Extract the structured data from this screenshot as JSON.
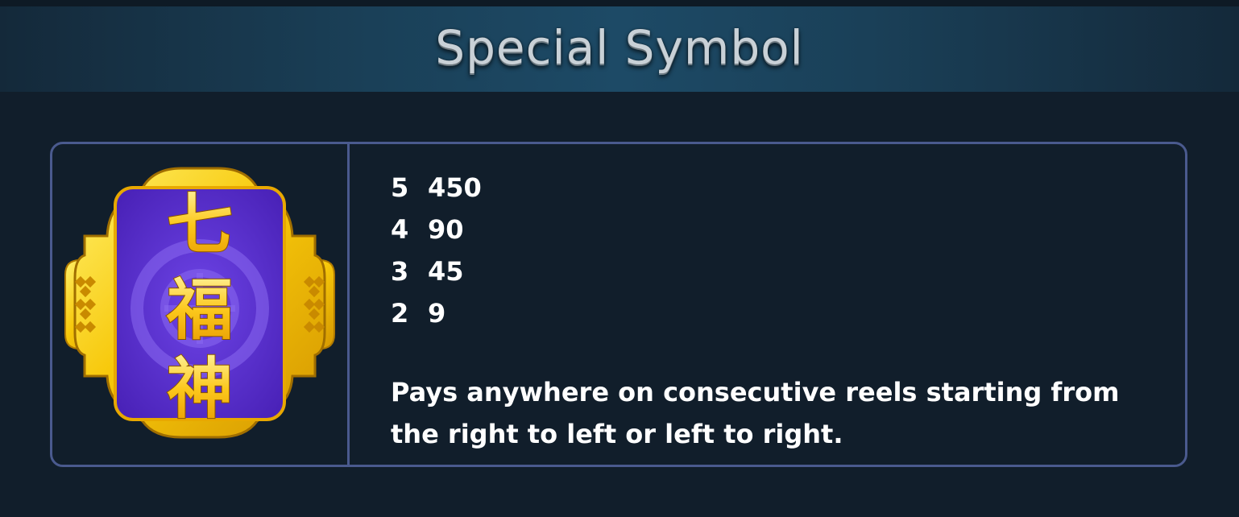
{
  "header": {
    "title": "Special Symbol"
  },
  "symbol": {
    "icon": "seven-lucky-gods-icon",
    "glyphs": [
      "七",
      "福",
      "神"
    ],
    "paytable": [
      {
        "count": "5",
        "payout": "450"
      },
      {
        "count": "4",
        "payout": "90"
      },
      {
        "count": "3",
        "payout": "45"
      },
      {
        "count": "2",
        "payout": "9"
      }
    ],
    "description": "Pays anywhere on consecutive reels starting from the right to left or left to right."
  },
  "colors": {
    "background": "#111e2b",
    "banner": "#1d4a66",
    "card_border": "#4a5a8e",
    "gold": "#f7c80a",
    "purple": "#5a2fd0"
  }
}
